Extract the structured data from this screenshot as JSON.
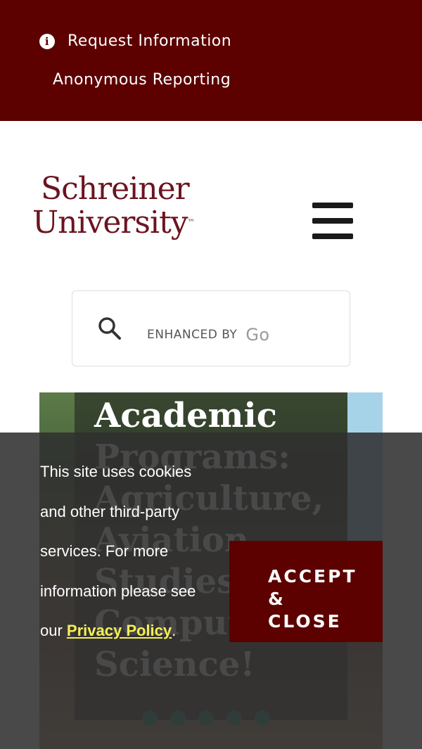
{
  "topbar": {
    "request_info": "Request Information",
    "anonymous_reporting": "Anonymous Reporting",
    "color": "#5c0000"
  },
  "header": {
    "logo_line1": "Schreiner",
    "logo_line2": "University",
    "logo_tm": "™",
    "menu_icon": "hamburger-menu-icon"
  },
  "search": {
    "icon": "search-icon",
    "enhanced_by": "ENHANCED BY",
    "brand_fragment": "Go"
  },
  "hero": {
    "title_lines": [
      "Academic",
      "Programs:",
      "Agriculture,",
      "Aviation",
      "Studies,",
      "Computer",
      "Science!"
    ],
    "dot_count": 5
  },
  "cookie": {
    "message_pre": "This site uses cookies and other third-party services. For more information please see our ",
    "privacy_link": "Privacy Policy",
    "message_post": ".",
    "accept_label": "ACCEPT & CLOSE"
  }
}
